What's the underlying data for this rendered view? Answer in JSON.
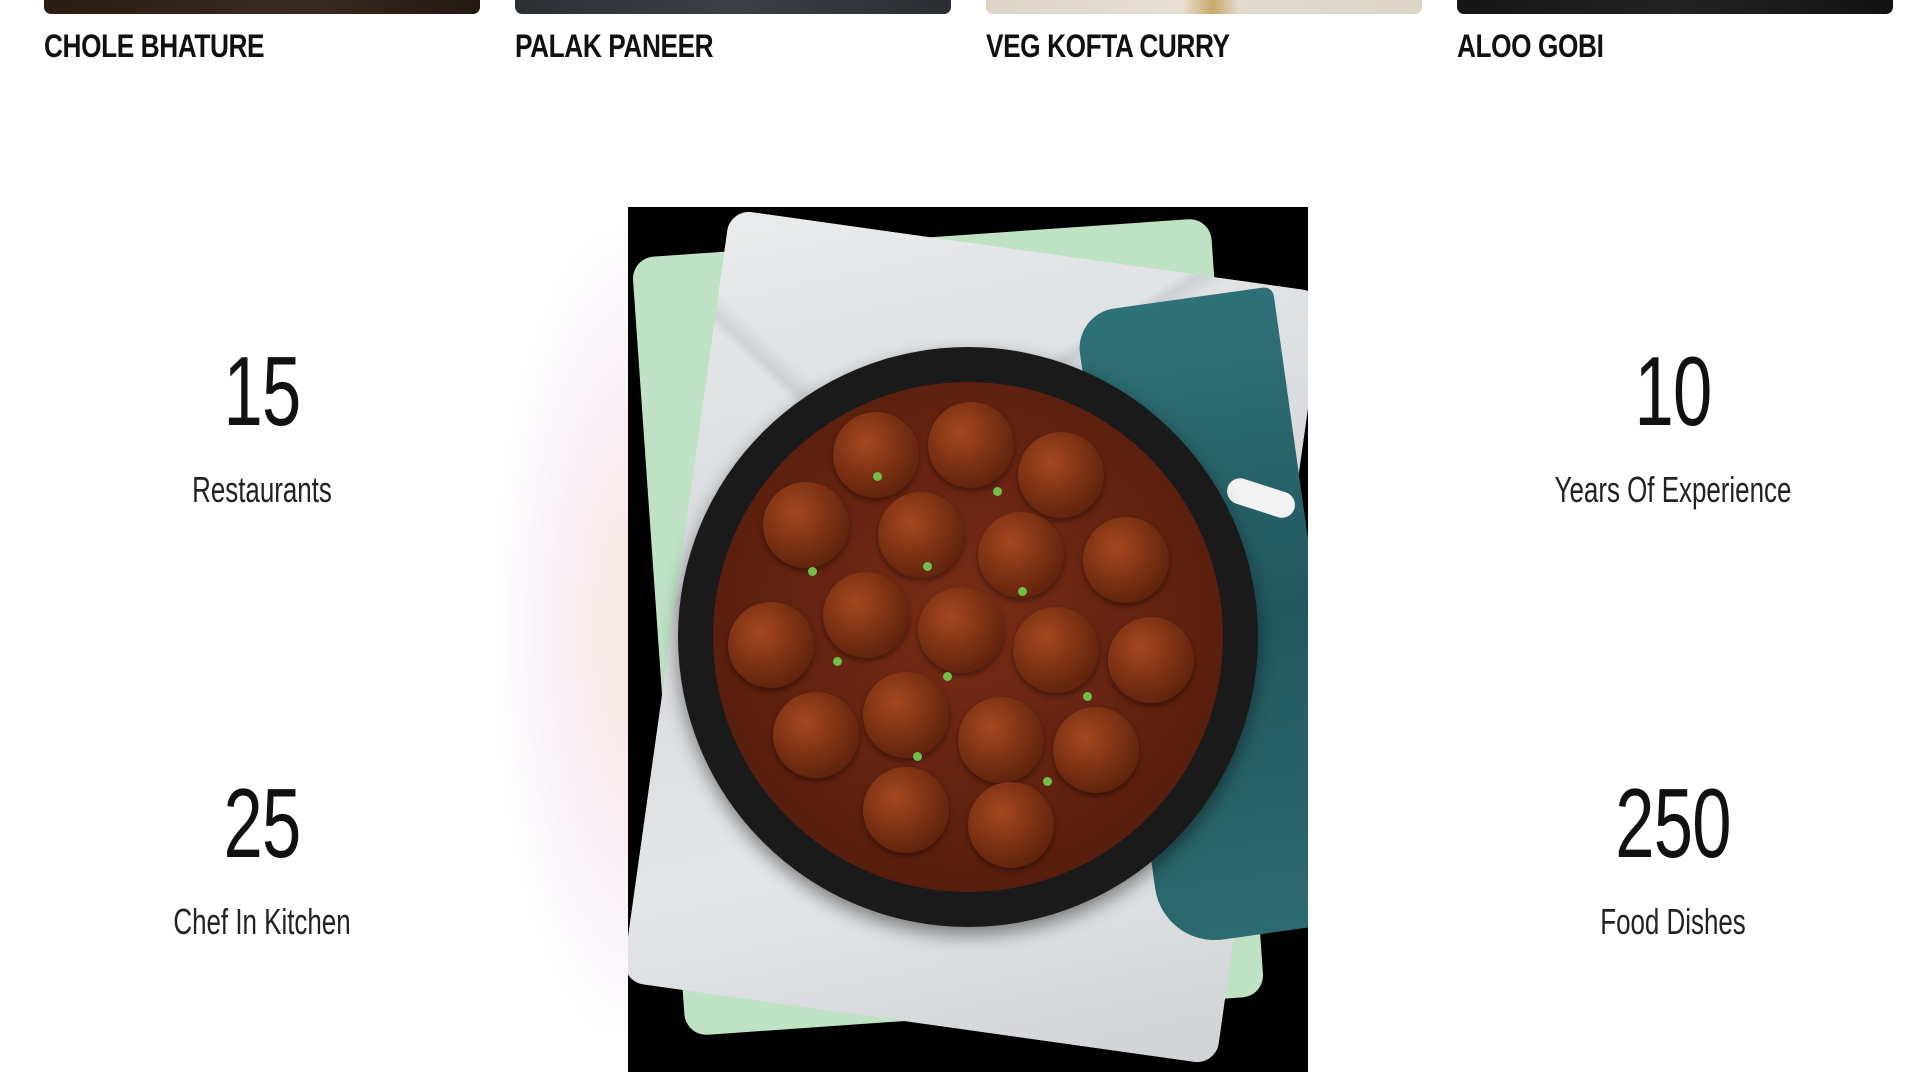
{
  "dishes": [
    {
      "name": "CHOLE BHATURE"
    },
    {
      "name": "PALAK PANEER"
    },
    {
      "name": "VEG KOFTA CURRY"
    },
    {
      "name": "ALOO GOBI"
    }
  ],
  "stats": {
    "restaurants": {
      "number": "15",
      "label": "Restaurants"
    },
    "years": {
      "number": "10",
      "label": "Years Of Experience"
    },
    "chefs": {
      "number": "25",
      "label": "Chef In Kitchen"
    },
    "dishes": {
      "number": "250",
      "label": "Food Dishes"
    }
  },
  "colors": {
    "text": "#111111",
    "background": "#ffffff",
    "board_mint": "#bfe2c4",
    "towel_teal": "#2f7177"
  }
}
